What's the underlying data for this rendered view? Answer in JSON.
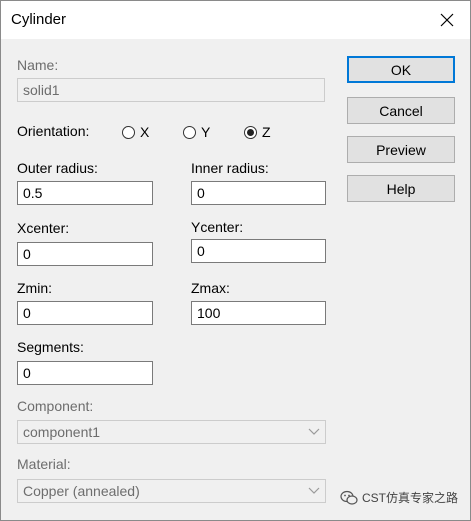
{
  "window": {
    "title": "Cylinder",
    "close_icon": "close-icon"
  },
  "fields": {
    "name": {
      "label": "Name:",
      "value": "solid1"
    },
    "orientation": {
      "label": "Orientation:",
      "options": [
        "X",
        "Y",
        "Z"
      ],
      "selected": "Z"
    },
    "outer_radius": {
      "label": "Outer radius:",
      "value": "0.5"
    },
    "inner_radius": {
      "label": "Inner radius:",
      "value": "0"
    },
    "xcenter": {
      "label": "Xcenter:",
      "value": "0"
    },
    "ycenter": {
      "label": "Ycenter:",
      "value": "0"
    },
    "zmin": {
      "label": "Zmin:",
      "value": "0"
    },
    "zmax": {
      "label": "Zmax:",
      "value": "100"
    },
    "segments": {
      "label": "Segments:",
      "value": "0"
    },
    "component": {
      "label": "Component:",
      "value": "component1"
    },
    "material": {
      "label": "Material:",
      "value": "Copper (annealed)"
    }
  },
  "buttons": {
    "ok": "OK",
    "cancel": "Cancel",
    "preview": "Preview",
    "help": "Help"
  },
  "watermark": {
    "text": "CST仿真专家之路",
    "icon": "wechat-icon"
  },
  "colors": {
    "default_button_border": "#0078d7",
    "disabled_text": "#6d6d6d"
  }
}
